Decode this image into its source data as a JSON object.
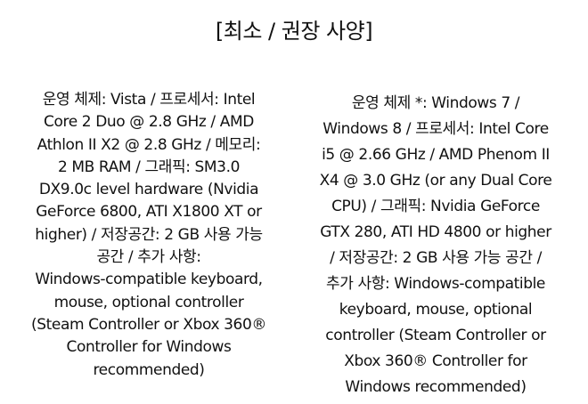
{
  "title": "[최소 / 권장 사양]",
  "minimum": {
    "lines": [
      "운영 체제: Vista / 프로세서: Intel",
      "Core 2 Duo @ 2.8 GHz / AMD",
      "Athlon II X2 @ 2.8 GHz / 메모리:",
      "2 MB RAM / 그래픽: SM3.0",
      "DX9.0c level hardware (Nvidia",
      "GeForce 6800, ATI X1800 XT or",
      "higher) / 저장공간: 2 GB 사용 가능",
      "공간 / 추가 사항:",
      "Windows-compatible keyboard,",
      "mouse, optional controller",
      "(Steam Controller or Xbox 360®",
      "Controller for Windows",
      "recommended)"
    ]
  },
  "recommended": {
    "lines": [
      "운영 체제 *: Windows 7 /",
      "Windows 8 / 프로세서: Intel Core",
      "i5 @ 2.66 GHz / AMD Phenom II",
      "X4 @ 3.0 GHz (or any Dual Core",
      "CPU) / 그래픽: Nvidia GeForce",
      "GTX 280, ATI HD 4800 or higher",
      "/ 저장공간: 2 GB 사용 가능 공간 /",
      "추가 사항: Windows-compatible",
      "keyboard, mouse, optional",
      "controller (Steam Controller or",
      "Xbox 360® Controller for",
      "Windows recommended)"
    ]
  }
}
